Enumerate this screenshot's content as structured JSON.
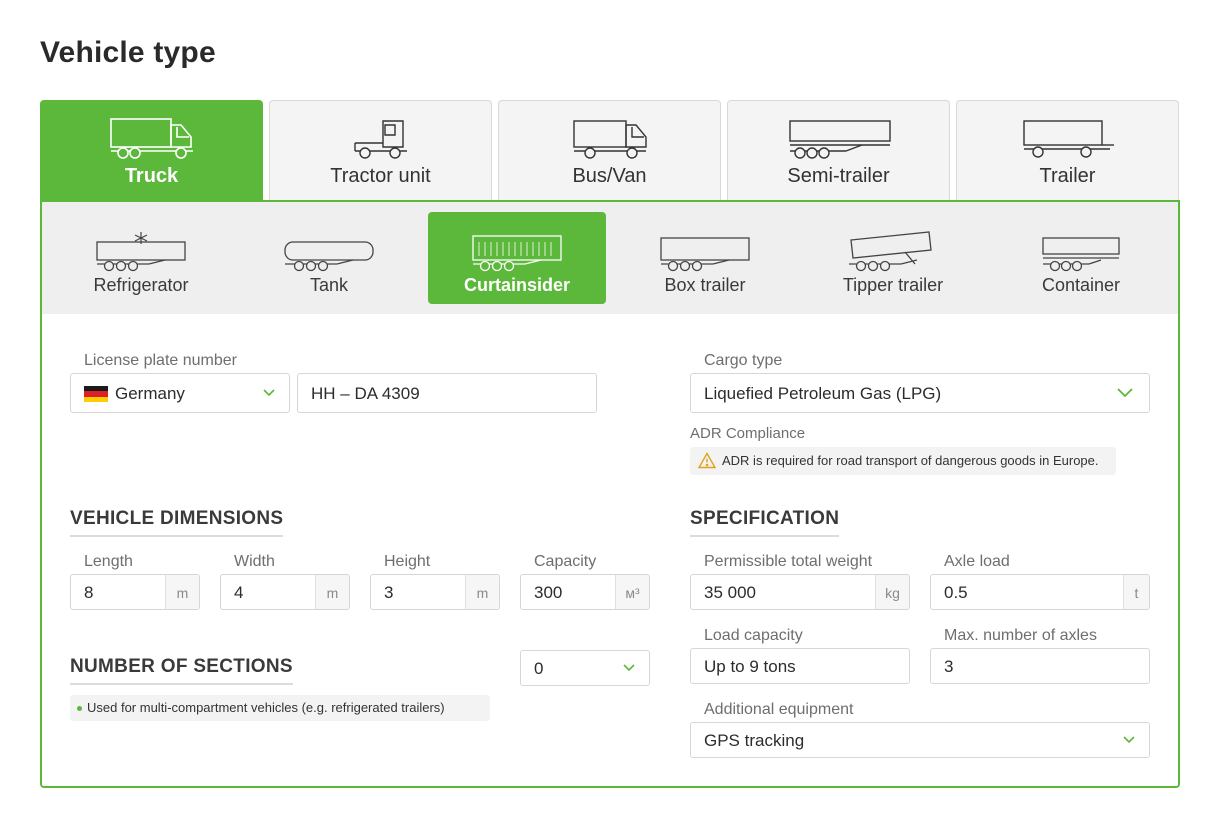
{
  "page_title": "Vehicle type",
  "vehicle_tabs": [
    {
      "label": "Truck",
      "icon": "truck-icon",
      "active": true
    },
    {
      "label": "Tractor unit",
      "icon": "tractor-unit-icon",
      "active": false
    },
    {
      "label": "Bus/Van",
      "icon": "bus-van-icon",
      "active": false
    },
    {
      "label": "Semi-trailer",
      "icon": "semi-trailer-icon",
      "active": false
    },
    {
      "label": "Trailer",
      "icon": "trailer-icon",
      "active": false
    }
  ],
  "body_tabs": [
    {
      "label": "Refrigerator",
      "icon": "refrigerator-trailer-icon",
      "active": false
    },
    {
      "label": "Tank",
      "icon": "tank-trailer-icon",
      "active": false
    },
    {
      "label": "Curtainsider",
      "icon": "curtainsider-trailer-icon",
      "active": true
    },
    {
      "label": "Box trailer",
      "icon": "box-trailer-icon",
      "active": false
    },
    {
      "label": "Tipper trailer",
      "icon": "tipper-trailer-icon",
      "active": false
    },
    {
      "label": "Container",
      "icon": "container-trailer-icon",
      "active": false
    }
  ],
  "license": {
    "label": "License plate number",
    "country": "Germany",
    "plate": "HH – DA 4309"
  },
  "cargo": {
    "label": "Cargo type",
    "value": "Liquefied Petroleum Gas (LPG)",
    "adr_label": "ADR Compliance",
    "adr_note": "ADR is required for road transport of dangerous goods in Europe."
  },
  "dimensions": {
    "title": "VEHICLE DIMENSIONS",
    "fields": [
      {
        "label": "Length",
        "value": "8",
        "unit": "m"
      },
      {
        "label": "Width",
        "value": "4",
        "unit": "m"
      },
      {
        "label": "Height",
        "value": "3",
        "unit": "m"
      },
      {
        "label": "Capacity",
        "value": "300",
        "unit": "м³"
      }
    ]
  },
  "sections": {
    "title": "NUMBER OF SECTIONS",
    "value": "0",
    "note": "Used for multi-compartment vehicles (e.g. refrigerated trailers)"
  },
  "specification": {
    "title": "SPECIFICATION",
    "total_weight": {
      "label": "Permissible total weight",
      "value": "35 000",
      "unit": "kg"
    },
    "axle_load": {
      "label": "Axle load",
      "value": "0.5",
      "unit": "t"
    },
    "load_capacity": {
      "label": "Load capacity",
      "value": "Up to 9 tons"
    },
    "max_axles": {
      "label": "Max. number of axles",
      "value": "3"
    },
    "equipment": {
      "label": "Additional equipment",
      "value": "GPS tracking"
    }
  },
  "colors": {
    "accent": "#5cb83a",
    "warning": "#e0a21a"
  }
}
